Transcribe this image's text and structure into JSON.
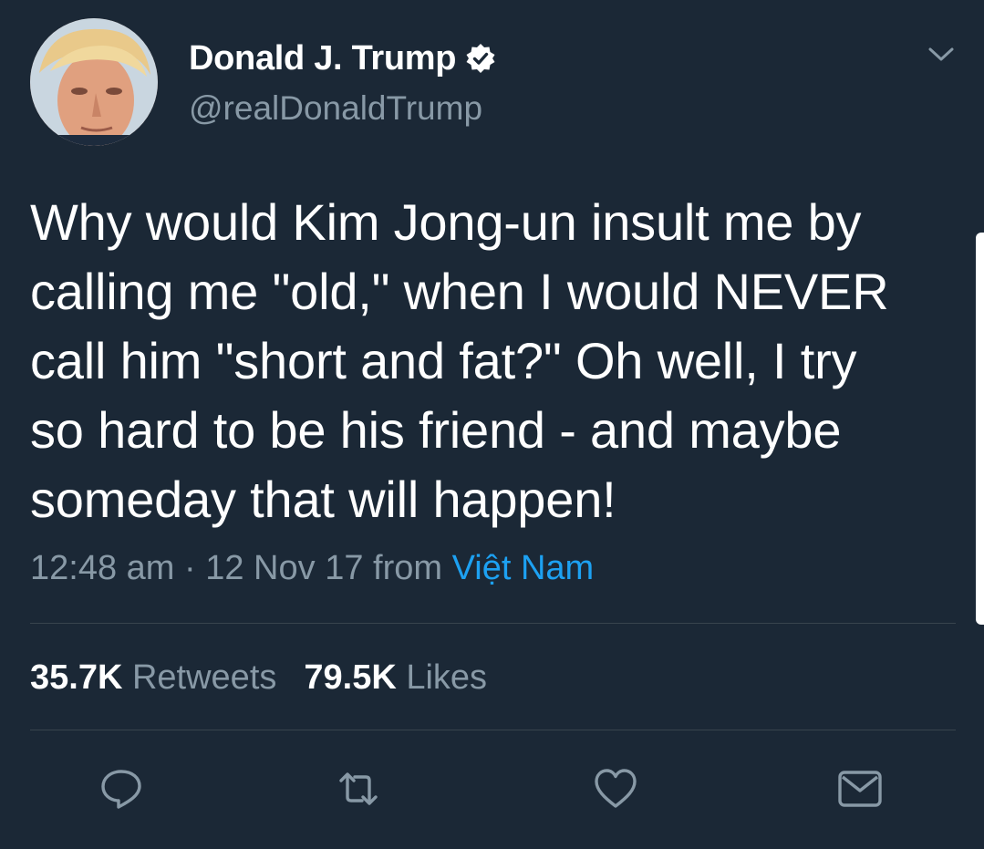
{
  "author": {
    "display_name": "Donald J. Trump",
    "handle": "@realDonaldTrump",
    "verified": true
  },
  "tweet": {
    "text": "Why would Kim Jong-un insult me by\ncalling me \"old,\" when I would NEVER\ncall him \"short and fat?\" Oh well, I try\nso hard to be his friend - and maybe\nsomeday that will happen!",
    "time": "12:48 am",
    "separator": "·",
    "date": "12 Nov 17",
    "from_label": "from",
    "location": "Việt Nam"
  },
  "stats": {
    "retweets_count": "35.7K",
    "retweets_label": "Retweets",
    "likes_count": "79.5K",
    "likes_label": "Likes"
  },
  "actions": [
    {
      "icon": "reply-icon"
    },
    {
      "icon": "retweet-icon"
    },
    {
      "icon": "like-icon"
    },
    {
      "icon": "message-icon"
    }
  ],
  "colors": {
    "background": "#1b2836",
    "text": "#ffffff",
    "secondary": "#8899a6",
    "link": "#1da1f2",
    "divider": "#38444d"
  }
}
